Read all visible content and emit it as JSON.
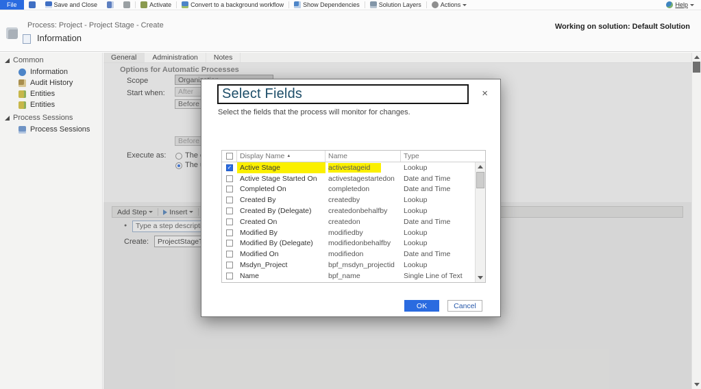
{
  "colors": {
    "accent_blue": "#2a6be0",
    "highlight_yellow": "#fbf000",
    "dialog_title_blue": "#1d4d68"
  },
  "ribbon": {
    "file": "File",
    "save_and_close": "Save and Close",
    "activate": "Activate",
    "convert": "Convert to a background workflow",
    "show_dependencies": "Show Dependencies",
    "solution_layers": "Solution Layers",
    "actions": "Actions",
    "help": "Help"
  },
  "header": {
    "breadcrumb": "Process: Project - Project Stage - Create",
    "title": "Information",
    "working_on": "Working on solution: Default Solution"
  },
  "sidebar": {
    "sections": [
      {
        "label": "Common",
        "items": [
          "Information",
          "Audit History",
          "Entities",
          "Entities"
        ]
      },
      {
        "label": "Process Sessions",
        "items": [
          "Process Sessions"
        ]
      }
    ]
  },
  "tabs": [
    {
      "label": "General"
    },
    {
      "label": "Administration"
    },
    {
      "label": "Notes"
    }
  ],
  "form": {
    "section_title": "Options for Automatic Processes",
    "scope_label": "Scope",
    "scope_value": "Organization",
    "start_when_label": "Start when:",
    "start_when_values": [
      "After",
      "Before",
      "Before"
    ],
    "execute_as_label": "Execute as:",
    "execute_options": [
      "The owner",
      "The user"
    ]
  },
  "step_editor": {
    "add_step": "Add Step",
    "insert": "Insert",
    "description_placeholder": "Type a step description here",
    "create_label": "Create:",
    "create_value": "ProjectStageTrack"
  },
  "dialog": {
    "title": "Select Fields",
    "subtitle": "Select the fields that the process will monitor for changes.",
    "columns": [
      "Display Name",
      "Name",
      "Type"
    ],
    "rows": [
      {
        "display": "Active Stage",
        "name": "activestageid",
        "type": "Lookup",
        "checked": true,
        "highlight": true
      },
      {
        "display": "Active Stage Started On",
        "name": "activestagestartedon",
        "type": "Date and Time",
        "checked": false,
        "highlight": false
      },
      {
        "display": "Completed On",
        "name": "completedon",
        "type": "Date and Time",
        "checked": false,
        "highlight": false
      },
      {
        "display": "Created By",
        "name": "createdby",
        "type": "Lookup",
        "checked": false,
        "highlight": false
      },
      {
        "display": "Created By (Delegate)",
        "name": "createdonbehalfby",
        "type": "Lookup",
        "checked": false,
        "highlight": false
      },
      {
        "display": "Created On",
        "name": "createdon",
        "type": "Date and Time",
        "checked": false,
        "highlight": false
      },
      {
        "display": "Modified By",
        "name": "modifiedby",
        "type": "Lookup",
        "checked": false,
        "highlight": false
      },
      {
        "display": "Modified By (Delegate)",
        "name": "modifiedonbehalfby",
        "type": "Lookup",
        "checked": false,
        "highlight": false
      },
      {
        "display": "Modified On",
        "name": "modifiedon",
        "type": "Date and Time",
        "checked": false,
        "highlight": false
      },
      {
        "display": "Msdyn_Project",
        "name": "bpf_msdyn_projectid",
        "type": "Lookup",
        "checked": false,
        "highlight": false
      },
      {
        "display": "Name",
        "name": "bpf_name",
        "type": "Single Line of Text",
        "checked": false,
        "highlight": false
      }
    ],
    "ok": "OK",
    "cancel": "Cancel"
  },
  "icons": {
    "close": "×",
    "sort_asc": "▲",
    "check": "✓",
    "bullet": "●",
    "delete_x": "×"
  }
}
